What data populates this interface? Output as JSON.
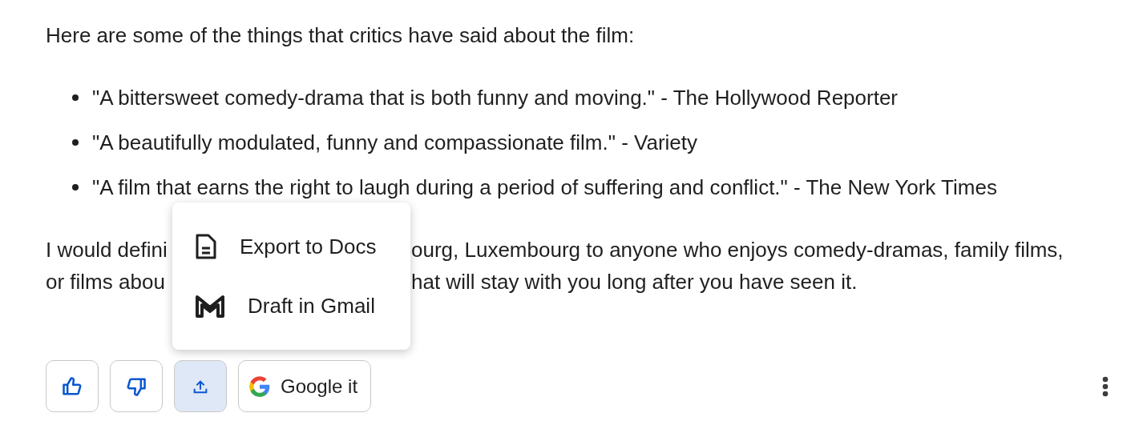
{
  "intro": "Here are some of the things that critics have said about the film:",
  "quotes": [
    "\"A bittersweet comedy-drama that is both funny and moving.\" - The Hollywood Reporter",
    "\"A beautifully modulated, funny and compassionate film.\" - Variety",
    "\"A film that earns the right to laugh during a period of suffering and conflict.\" - The New York Times"
  ],
  "paragraph_lines": [
    {
      "left": "I would defini",
      "right": "ourg, Luxembourg to anyone who enjoys comedy-dramas, family films,"
    },
    {
      "left": "or films abou",
      "right": "hat will stay with you long after you have seen it."
    }
  ],
  "share_menu": {
    "items": [
      {
        "kind": "docs",
        "label": "Export to Docs"
      },
      {
        "kind": "gmail",
        "label": "Draft in Gmail"
      }
    ]
  },
  "actions": [
    {
      "kind": "thumbs-up",
      "selected": false
    },
    {
      "kind": "thumbs-down",
      "selected": false
    },
    {
      "kind": "share",
      "selected": true
    },
    {
      "kind": "google",
      "label": "Google it",
      "selected": false
    }
  ]
}
